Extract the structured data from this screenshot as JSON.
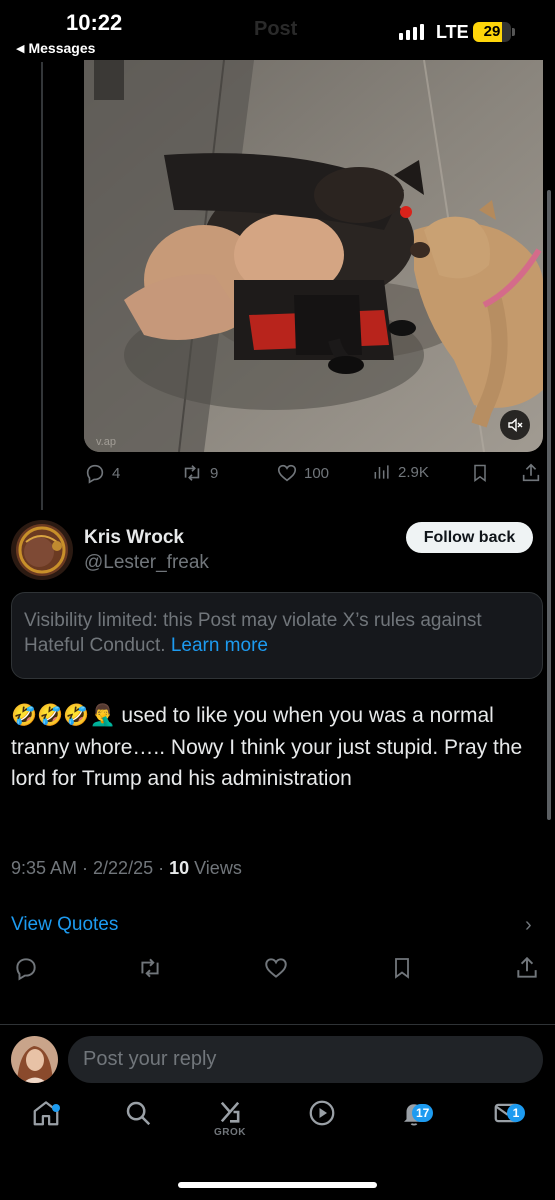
{
  "status_bar": {
    "time": "10:22",
    "back_app": "Messages",
    "ghost_title": "Post",
    "network": "LTE",
    "battery": "29",
    "battery_level_percent": 29,
    "battery_color": "#ffd60a"
  },
  "media": {
    "mute_icon": "speaker-mute-icon",
    "watermark": "v.ap"
  },
  "post_actions": {
    "replies": "4",
    "reposts": "9",
    "likes": "100",
    "views": "2.9K"
  },
  "reply": {
    "name": "Kris Wrock",
    "handle": "@Lester_freak",
    "follow_label": "Follow back",
    "notice_text": "Visibility limited: this Post may violate X’s rules against Hateful Conduct.",
    "notice_link": "Learn more",
    "emoji": "🤣🤣🤣🤦‍♂️",
    "text": " used to like you when you was a normal tranny whore….. Nowy I think your just stupid. Pray the lord for Trump and his administration",
    "meta_time": "9:35 AM · 2/22/25 · ",
    "views_count": "10",
    "views_label": " Views",
    "view_quotes": "View Quotes"
  },
  "composer": {
    "placeholder": "Post your reply"
  },
  "tabbar": {
    "grok_label": "GROK",
    "notifications_badge": "17",
    "messages_badge": "1"
  },
  "colors": {
    "accent": "#1d9bf0",
    "muted": "#71767b",
    "text": "#e7e9ea",
    "background": "#000000"
  }
}
